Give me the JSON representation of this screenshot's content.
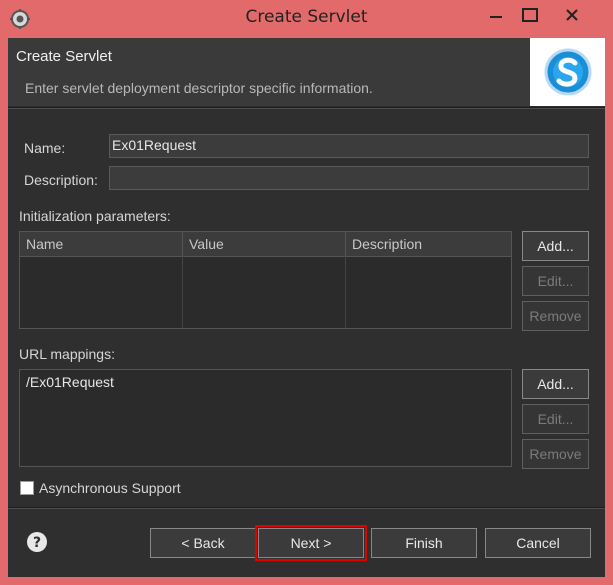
{
  "window": {
    "title": "Create Servlet"
  },
  "header": {
    "title": "Create Servlet",
    "description": "Enter servlet deployment descriptor specific information."
  },
  "form": {
    "name_label": "Name:",
    "name_value": "Ex01Request",
    "description_label": "Description:",
    "description_value": ""
  },
  "init_params": {
    "label": "Initialization parameters:",
    "columns": [
      "Name",
      "Value",
      "Description"
    ],
    "add_label": "Add...",
    "edit_label": "Edit...",
    "remove_label": "Remove"
  },
  "url_mappings": {
    "label": "URL mappings:",
    "items": [
      "/Ex01Request"
    ],
    "add_label": "Add...",
    "edit_label": "Edit...",
    "remove_label": "Remove"
  },
  "async": {
    "label": "Asynchronous Support",
    "checked": false
  },
  "footer": {
    "back_label": "< Back",
    "next_label": "Next >",
    "finish_label": "Finish",
    "cancel_label": "Cancel"
  },
  "icons": {
    "app": "gear-icon",
    "help": "help-icon",
    "logo": "servlet-logo-icon",
    "minimize": "minimize-icon",
    "maximize": "maximize-icon",
    "close": "close-icon"
  },
  "colors": {
    "frame": "#e26a6a",
    "client_bg": "#2f2f2f",
    "highlight": "#e00000"
  }
}
